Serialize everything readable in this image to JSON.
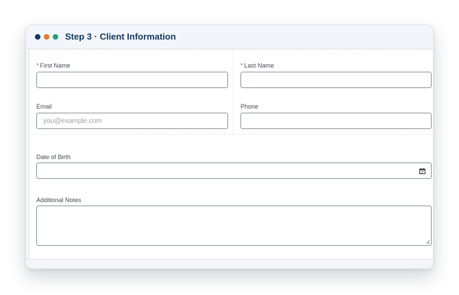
{
  "form": {
    "title": "Step 3 · Client Information",
    "colors": {
      "dot_1": "#13395d",
      "dot_2": "#e6792d",
      "dot_3": "#1fa27d",
      "title": "#16385d",
      "required_marker": "#d24a4a"
    },
    "first_name": {
      "label": "First Name",
      "required_marker": "*",
      "value": ""
    },
    "last_name": {
      "label": "Last Name",
      "required_marker": "*",
      "value": ""
    },
    "email": {
      "label": "Email",
      "placeholder": "you@example.com",
      "value": ""
    },
    "phone": {
      "label": "Phone",
      "value": ""
    },
    "date_of_birth": {
      "label": "Date of Birth",
      "value": "",
      "icon": "calendar-icon"
    },
    "notes": {
      "label": "Additional Notes",
      "value": ""
    }
  }
}
